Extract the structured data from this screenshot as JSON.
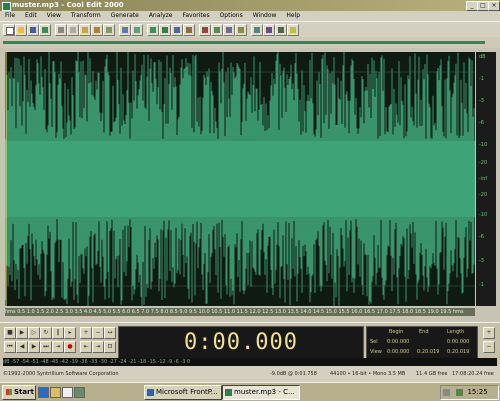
{
  "window": {
    "title": "muster.mp3 - Cool Edit 2000"
  },
  "menu": [
    "File",
    "Edit",
    "View",
    "Transform",
    "Generate",
    "Analyze",
    "Favorites",
    "Options",
    "Window",
    "Help"
  ],
  "wave_ruler_right": [
    "dB",
    "-1",
    "-3",
    "-6",
    "-10",
    "-20",
    "-inf",
    "-20",
    "-10",
    "-6",
    "-3",
    "-1"
  ],
  "wave_ruler_bottom": "hms 0.5 1.0 1.5 2.0 2.5 3.0 3.5 4.0 4.5 5.0 5.5 6.0 6.5 7.0 7.5 8.0 8.5 9.0 9.5 10.0 10.5 11.0 11.5 12.0 12.5 13.0 13.5 14.0 14.5 15.0 15.5 16.0 16.5 17.0 17.5 18.0 18.5 19.0 19.5 hms",
  "transport": {
    "time": "0:00.000"
  },
  "info": {
    "begin_label": "Begin",
    "end_label": "End",
    "length_label": "Length",
    "sel_label": "Sel",
    "view_label": "View",
    "sel_begin": "0:00.000",
    "sel_end": "",
    "sel_length": "0:00.000",
    "view_begin": "0:00.000",
    "view_end": "0:20.019",
    "view_length": "0:20.019"
  },
  "level_scale": "dB -57 -54 -51 -48 -45 -42 -39 -36 -33 -30 -27 -24 -21 -18 -15 -12 -9 -6 -3 0",
  "status": {
    "copyright": "©1992-2000 Syntrillium Software Corporation",
    "peak": "-9.0dB @ 0:01.758",
    "format": "44100 • 16-bit • Mono",
    "size": "3.5 MB",
    "free_space": "11.4 GB free",
    "free_time": "17:08:20.24 free"
  },
  "taskbar": {
    "start": "Start",
    "task1": "Microsoft FrontP...",
    "task2": "muster.mp3 - C...",
    "clock": "15:25"
  },
  "colors": {
    "wave": "#3fa377",
    "wave_bg": "#0f1a12",
    "time_text": "#f0e090"
  }
}
